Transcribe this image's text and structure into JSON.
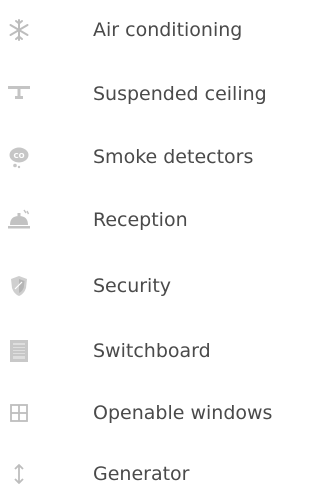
{
  "features": {
    "items": [
      {
        "label": "Air conditioning",
        "icon": "snowflake-icon"
      },
      {
        "label": "Suspended ceiling",
        "icon": "ceiling-icon"
      },
      {
        "label": "Smoke detectors",
        "icon": "smoke-detector-icon"
      },
      {
        "label": "Reception",
        "icon": "reception-bell-icon"
      },
      {
        "label": "Security",
        "icon": "shield-icon"
      },
      {
        "label": "Switchboard",
        "icon": "switchboard-icon"
      },
      {
        "label": "Openable windows",
        "icon": "window-icon"
      },
      {
        "label": "Generator",
        "icon": "generator-icon"
      }
    ]
  },
  "colors": {
    "text": "#4a4a4a",
    "icon": "#bdbdbd"
  }
}
